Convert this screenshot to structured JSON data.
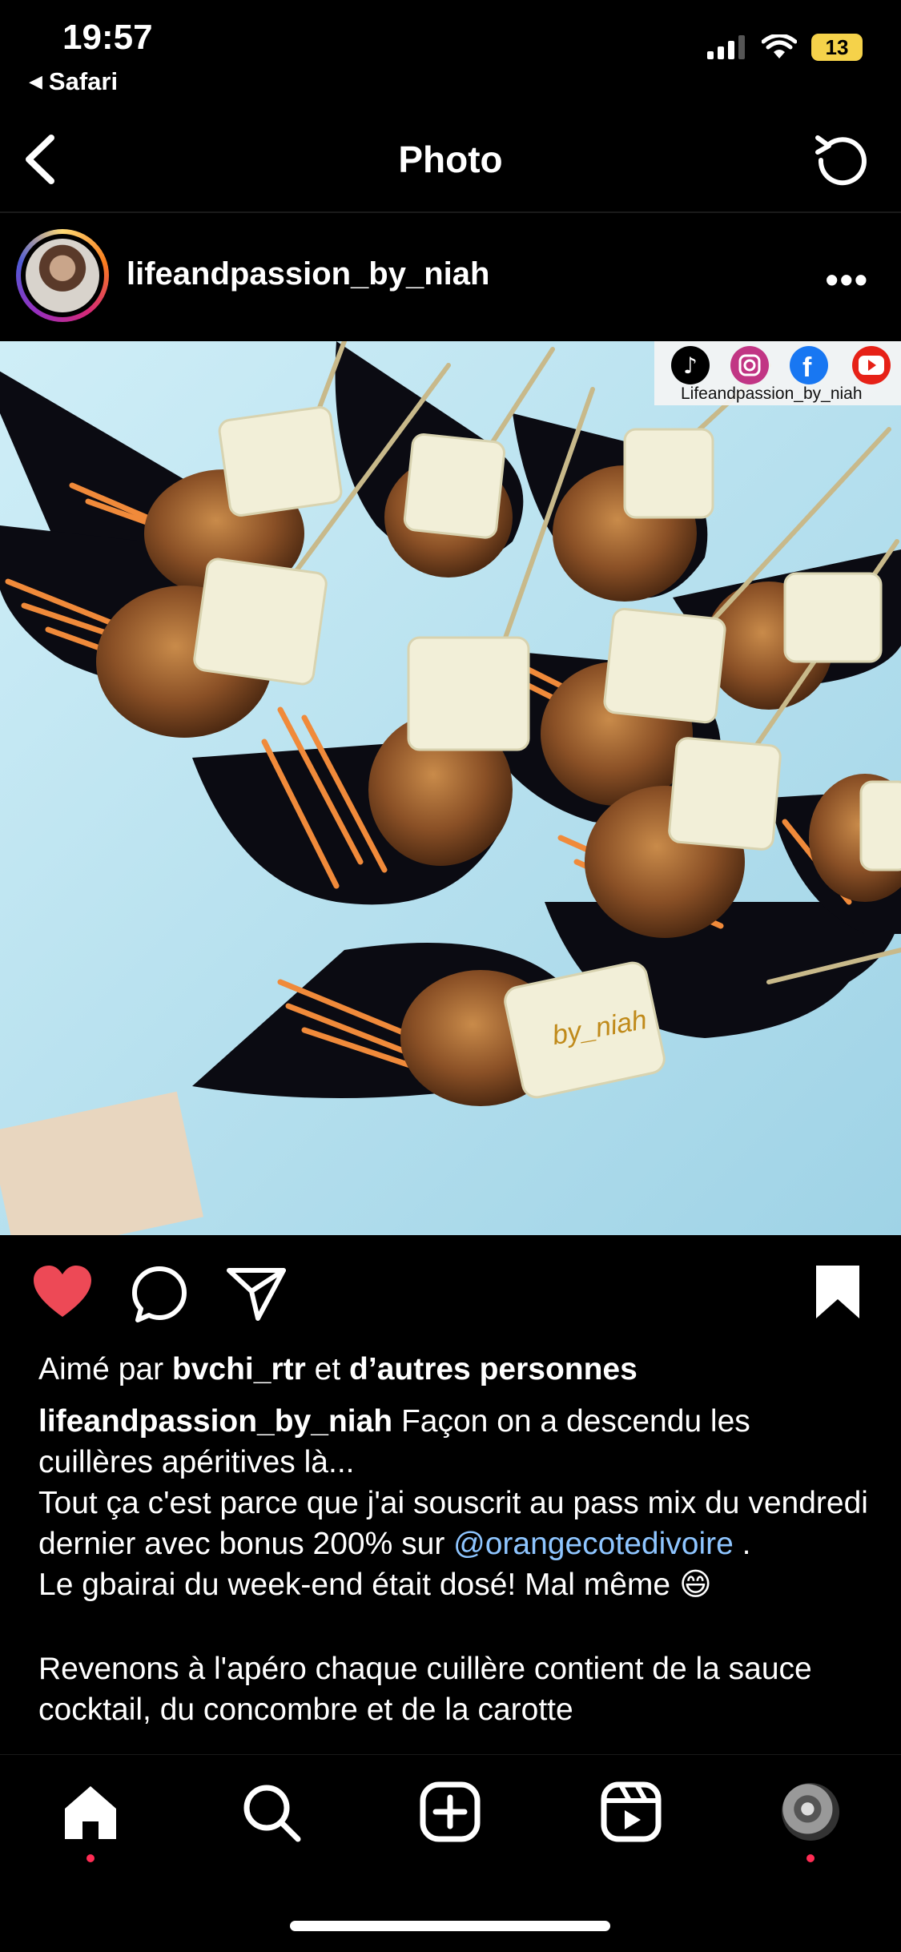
{
  "status_bar": {
    "time": "19:57",
    "back_app": "Safari",
    "battery": "13",
    "battery_color": "#f5d24a"
  },
  "nav": {
    "title": "Photo",
    "back_icon": "chevron-left-icon",
    "refresh_icon": "refresh-icon"
  },
  "post": {
    "username": "lifeandpassion_by_niah",
    "photo": {
      "watermark_handle": "Lifeandpassion_by_niah",
      "brand_mark": "by_niah",
      "social_icons": [
        "tiktok-icon",
        "instagram-icon",
        "facebook-icon",
        "youtube-icon"
      ]
    },
    "actions": {
      "liked": true,
      "like_color": "#ed4956"
    },
    "likes": {
      "prefix": "Aimé par",
      "user": "bvchi_rtr",
      "middle": "et",
      "others": "d’autres personnes"
    },
    "caption": {
      "author": "lifeandpassion_by_niah",
      "line1": "Façon on a descendu les cuillères apéritives là...",
      "line2": "Tout ça c'est parce que j'ai souscrit au pass mix du vendredi dernier avec bonus 200% sur",
      "mention": "@orangecotedivoire",
      "line2_end": " .",
      "line3": "Le gbairai du week-end était dosé! Mal même 😄",
      "line4": "Revenons à l'apéro chaque cuillère contient de la sauce cocktail, du concombre et de la carotte"
    }
  },
  "tabbar": {
    "tabs": [
      "home-icon",
      "search-icon",
      "new-post-icon",
      "reels-icon",
      "profile-avatar"
    ],
    "active": "home-icon",
    "badge_color": "#ff2d55"
  }
}
